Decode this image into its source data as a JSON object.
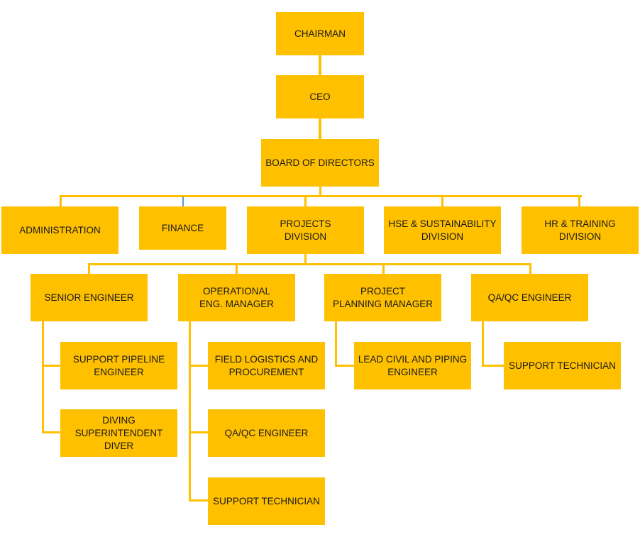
{
  "colors": {
    "box_fill": "#FFC000",
    "connector": "#FFC000",
    "text": "#1a1a1a"
  },
  "org_chart": {
    "top": {
      "chairman": [
        "CHAIRMAN"
      ],
      "ceo": [
        "CEO"
      ],
      "board": [
        "BOARD OF DIRECTORS"
      ]
    },
    "departments": {
      "administration": [
        "ADMINISTRATION"
      ],
      "finance": [
        "FINANCE"
      ],
      "projects": [
        "PROJECTS",
        "DIVISION"
      ],
      "hse": [
        "HSE & SUSTAINABILITY",
        "DIVISION"
      ],
      "hr": [
        "HR & TRAINING",
        "DIVISION"
      ]
    },
    "project_roles": {
      "senior_engineer": {
        "title": [
          "SENIOR ENGINEER"
        ],
        "reports": [
          [
            "SUPPORT PIPELINE",
            "ENGINEER"
          ],
          [
            "DIVING",
            "SUPERINTENDENT",
            "DIVER"
          ]
        ]
      },
      "operational_manager": {
        "title": [
          "OPERATIONAL",
          "ENG. MANAGER"
        ],
        "reports": [
          [
            "FIELD LOGISTICS AND",
            "PROCUREMENT"
          ],
          [
            "QA/QC ENGINEER"
          ],
          [
            "SUPPORT TECHNICIAN"
          ]
        ]
      },
      "planning_manager": {
        "title": [
          "PROJECT",
          "PLANNING MANAGER"
        ],
        "reports": [
          [
            "LEAD CIVIL AND PIPING",
            "ENGINEER"
          ]
        ]
      },
      "qaqc_engineer": {
        "title": [
          "QA/QC ENGINEER"
        ],
        "reports": [
          [
            "SUPPORT TECHNICIAN"
          ]
        ]
      }
    }
  }
}
